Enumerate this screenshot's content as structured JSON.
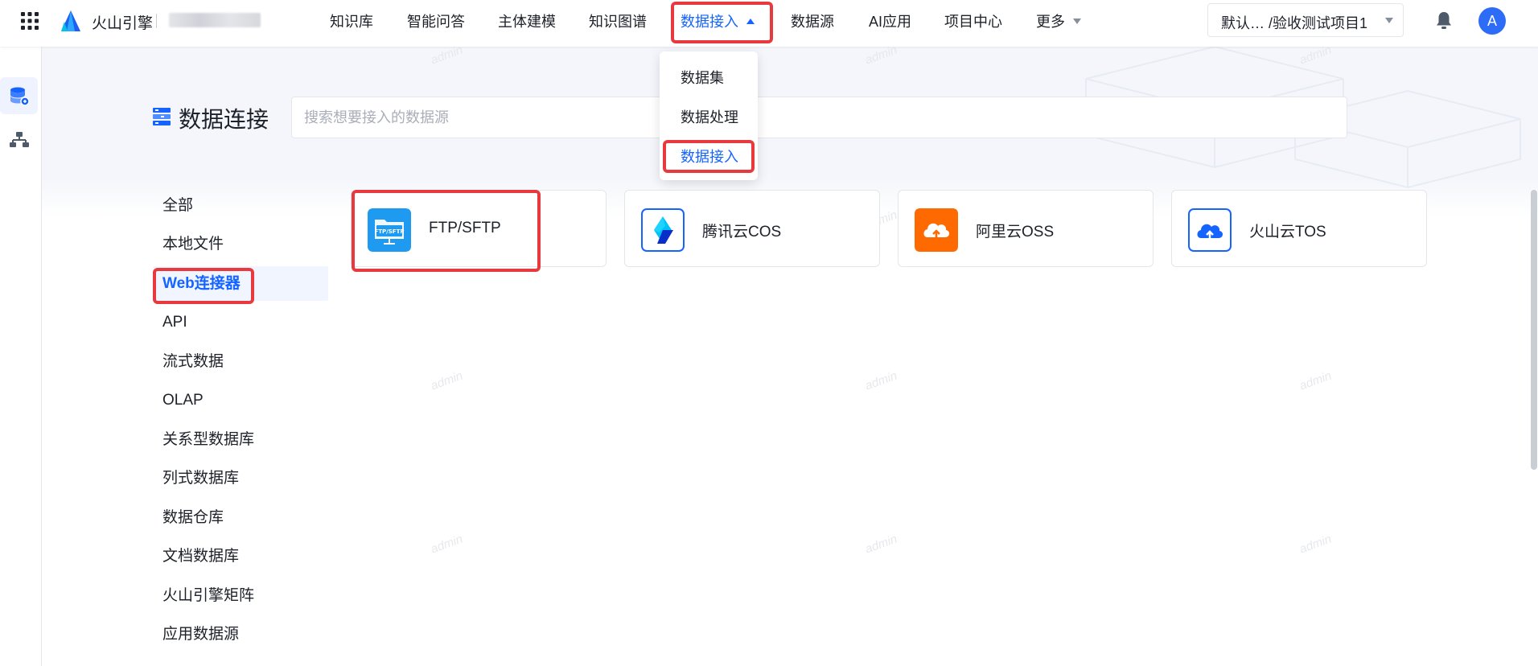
{
  "header": {
    "brand": "火山引擎",
    "nav": [
      {
        "label": "知识库"
      },
      {
        "label": "智能问答"
      },
      {
        "label": "主体建模"
      },
      {
        "label": "知识图谱"
      },
      {
        "label": "数据接入"
      },
      {
        "label": "数据源"
      },
      {
        "label": "AI应用"
      },
      {
        "label": "项目中心"
      },
      {
        "label": "更多"
      }
    ],
    "active_nav": "数据接入",
    "project_selector": "默认…  /验收测试项目1",
    "avatar_initial": "A"
  },
  "dropdown": {
    "items": [
      {
        "label": "数据集"
      },
      {
        "label": "数据处理"
      },
      {
        "label": "数据接入"
      }
    ],
    "active": "数据接入"
  },
  "page": {
    "title": "数据连接",
    "search_placeholder": "搜索想要接入的数据源"
  },
  "categories": [
    {
      "label": "全部"
    },
    {
      "label": "本地文件"
    },
    {
      "label": "Web连接器"
    },
    {
      "label": "API"
    },
    {
      "label": "流式数据"
    },
    {
      "label": "OLAP"
    },
    {
      "label": "关系型数据库"
    },
    {
      "label": "列式数据库"
    },
    {
      "label": "数据仓库"
    },
    {
      "label": "文档数据库"
    },
    {
      "label": "火山引擎矩阵"
    },
    {
      "label": "应用数据源"
    }
  ],
  "active_category": "Web连接器",
  "connectors": [
    {
      "label": "FTP/SFTP",
      "icon": "ftp-folder-icon",
      "icon_text": "FTP/SFTP"
    },
    {
      "label": "腾讯云COS",
      "icon": "tencent-cloud-icon"
    },
    {
      "label": "阿里云OSS",
      "icon": "aliyun-cloud-upload-icon"
    },
    {
      "label": "火山云TOS",
      "icon": "volcano-cloud-upload-icon"
    }
  ],
  "watermark": "admin",
  "colors": {
    "accent": "#1664ff",
    "highlight_box": "#e8393f",
    "aliyun_orange": "#ff6a00",
    "ftp_blue": "#1e9bf0"
  }
}
